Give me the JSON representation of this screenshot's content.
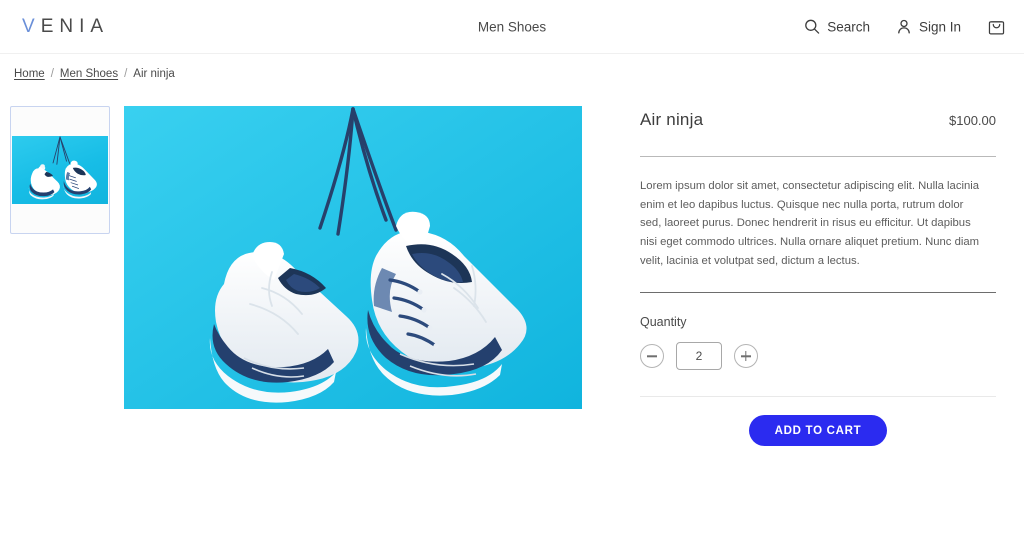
{
  "header": {
    "logo": "VENIA",
    "logo_accent_letter": "V",
    "nav_center": "Men Shoes",
    "search_label": "Search",
    "signin_label": "Sign In",
    "search_icon": "search-icon",
    "account_icon": "person-icon",
    "cart_icon": "shopping-bag-icon"
  },
  "breadcrumb": {
    "home": "Home",
    "category": "Men Shoes",
    "current": "Air ninja",
    "separator": "/"
  },
  "gallery": {
    "thumbnail_alt": "white sneakers hanging by laces on cyan background",
    "main_image_alt": "pair of white and navy sneakers hanging by their laces against a bright cyan background",
    "background_color": "#1dc3e9",
    "thumb_border_color": "#c8d4f0"
  },
  "product": {
    "title": "Air ninja",
    "price": "$100.00",
    "description": "Lorem ipsum dolor sit amet, consectetur adipiscing elit. Nulla lacinia enim et leo dapibus luctus. Quisque nec nulla porta, rutrum dolor sed, laoreet purus. Donec hendrerit in risus eu efficitur. Ut dapibus nisi eget commodo ultrices. Nulla ornare aliquet pretium. Nunc diam velit, lacinia et volutpat sed, dictum a lectus."
  },
  "quantity": {
    "label": "Quantity",
    "value": "2",
    "decrement_icon": "minus-circle-icon",
    "increment_icon": "plus-circle-icon"
  },
  "cta": {
    "add_to_cart_label": "ADD TO CART",
    "accent_color": "#2b2bf0"
  }
}
